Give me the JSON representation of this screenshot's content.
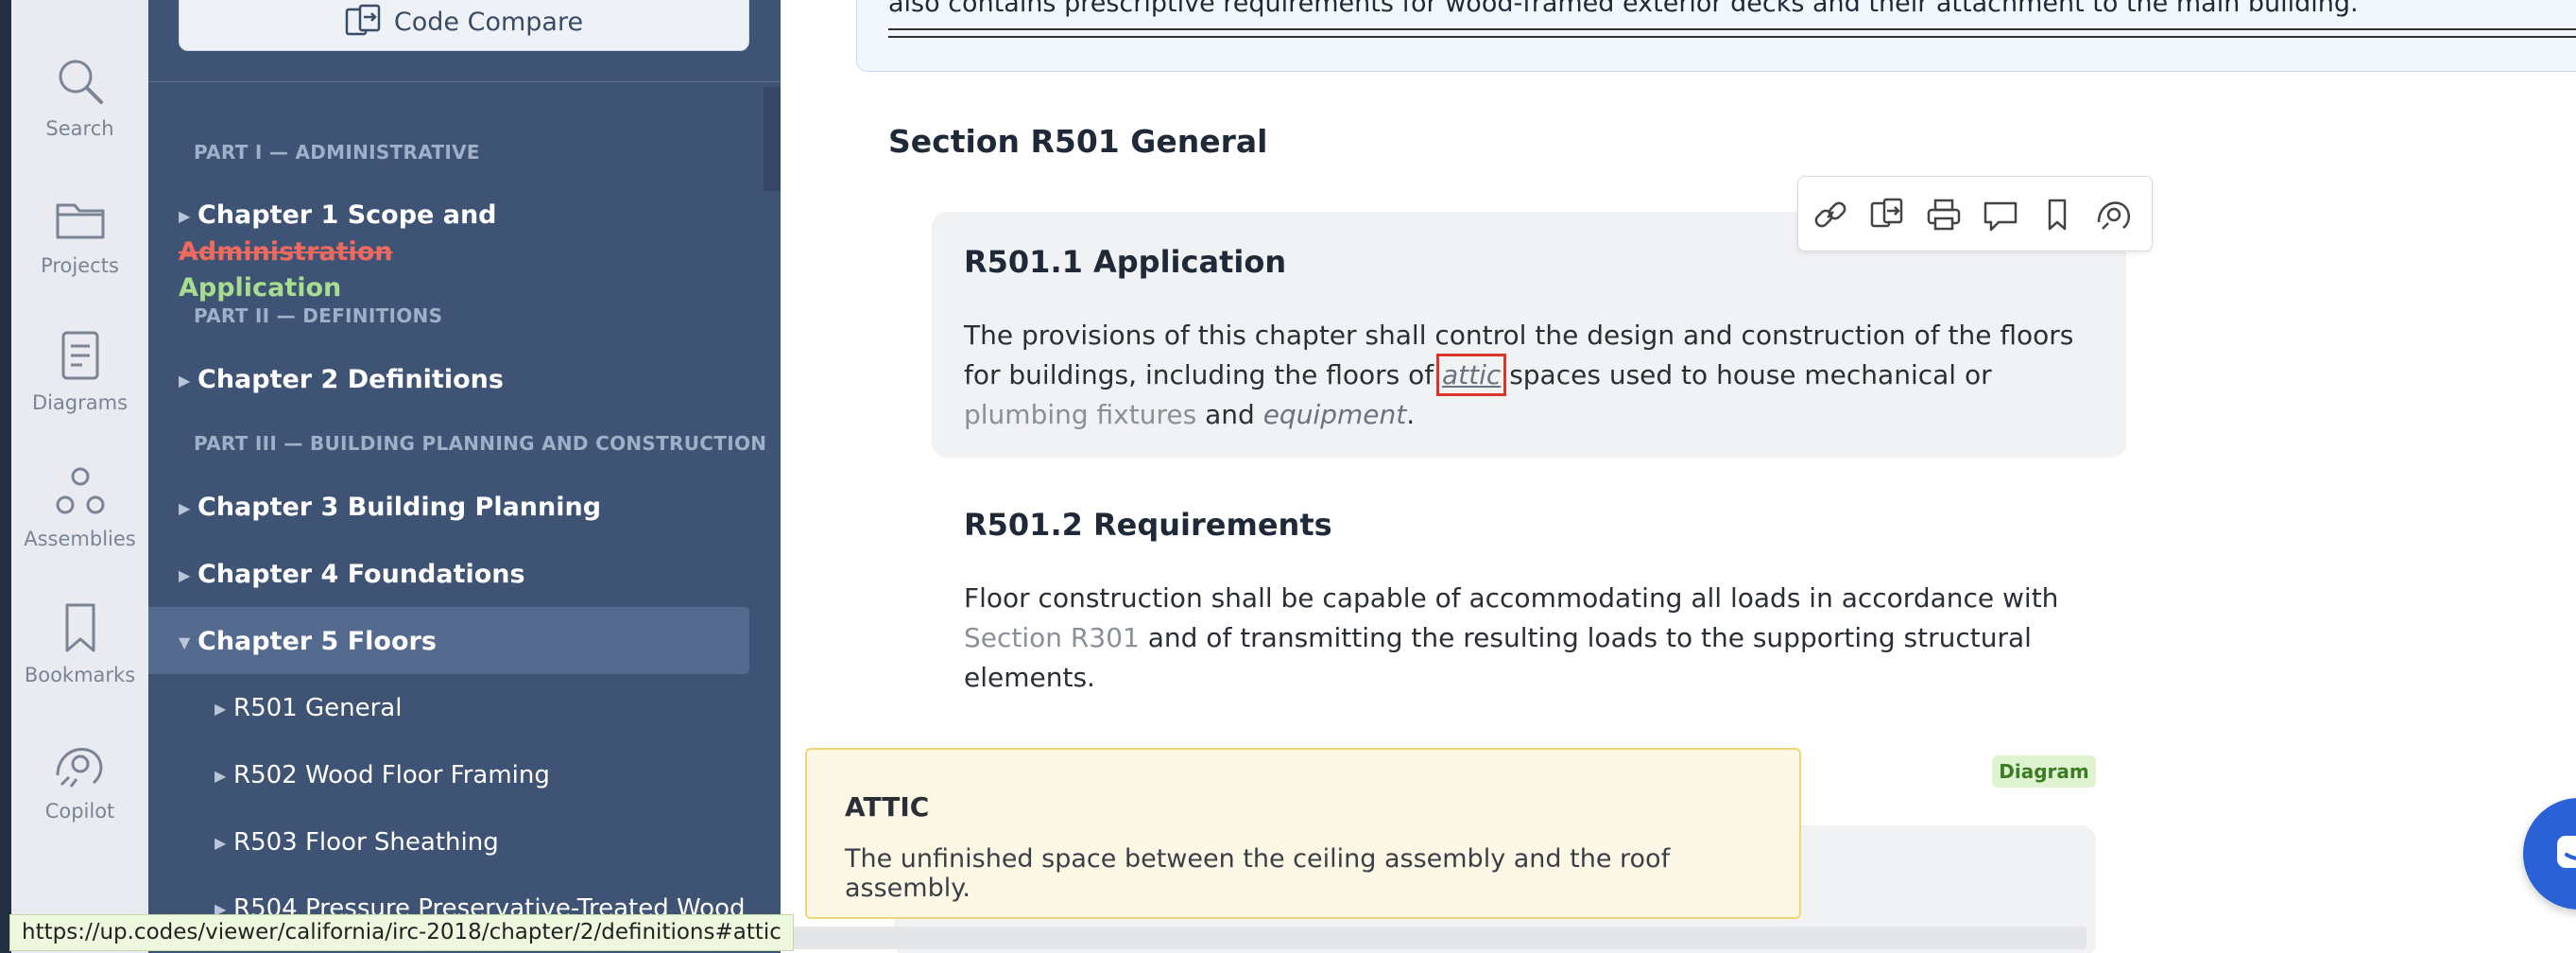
{
  "rail": {
    "items": [
      {
        "label": "Search",
        "icon": "search-icon"
      },
      {
        "label": "Projects",
        "icon": "folder-icon"
      },
      {
        "label": "Diagrams",
        "icon": "diagram-doc-icon"
      },
      {
        "label": "Assemblies",
        "icon": "assemblies-icon"
      },
      {
        "label": "Bookmarks",
        "icon": "bookmark-icon"
      },
      {
        "label": "Copilot",
        "icon": "copilot-icon"
      }
    ]
  },
  "sidebar": {
    "code_compare_label": "Code Compare",
    "parts": [
      "PART I — ADMINISTRATIVE",
      "PART II — DEFINITIONS",
      "PART III — BUILDING PLANNING AND CONSTRUCTION"
    ],
    "chapter1": {
      "prefix": "Chapter 1 Scope and ",
      "struck": "Administration",
      "added": "Application"
    },
    "chapters": [
      "Chapter 2 Definitions",
      "Chapter 3 Building Planning",
      "Chapter 4 Foundations",
      "Chapter 5 Floors"
    ],
    "sections": [
      "R501 General",
      "R502 Wood Floor Framing",
      "R503 Floor Sheathing",
      "R504 Pressure Preservative-Treated Wood"
    ]
  },
  "main": {
    "intro_text": "also contains prescriptive requirements for wood-framed exterior decks and their attachment to the main building.",
    "section_title": "Section R501 General",
    "r501_1": {
      "heading": "R501.1 Application",
      "text_before": "The provisions of this chapter shall control the design and construction of the floors for buildings, including the floors of ",
      "attic": "attic",
      "text_mid": " spaces used to house mechanical or ",
      "plumbing": "plumbing fixtures",
      "and": " and ",
      "equipment": "equipment",
      "period": "."
    },
    "r501_2": {
      "heading": "R501.2 Requirements",
      "text_before": "Floor construction shall be capable of accommodating all loads in accordance with ",
      "link": "Section R301",
      "text_after": " and of transmitting the resulting loads to the supporting structural elements."
    },
    "diagram_badge": "Diagram",
    "tooltip": {
      "title": "ATTIC",
      "text": "The unfinished space between the ceiling assembly and the roof assembly."
    },
    "toolbar_icons": [
      "link-icon",
      "compare-icon",
      "print-icon",
      "comment-icon",
      "bookmark-icon",
      "copilot-icon"
    ]
  },
  "status_url": "https://up.codes/viewer/california/irc-2018/chapter/2/definitions#attic"
}
